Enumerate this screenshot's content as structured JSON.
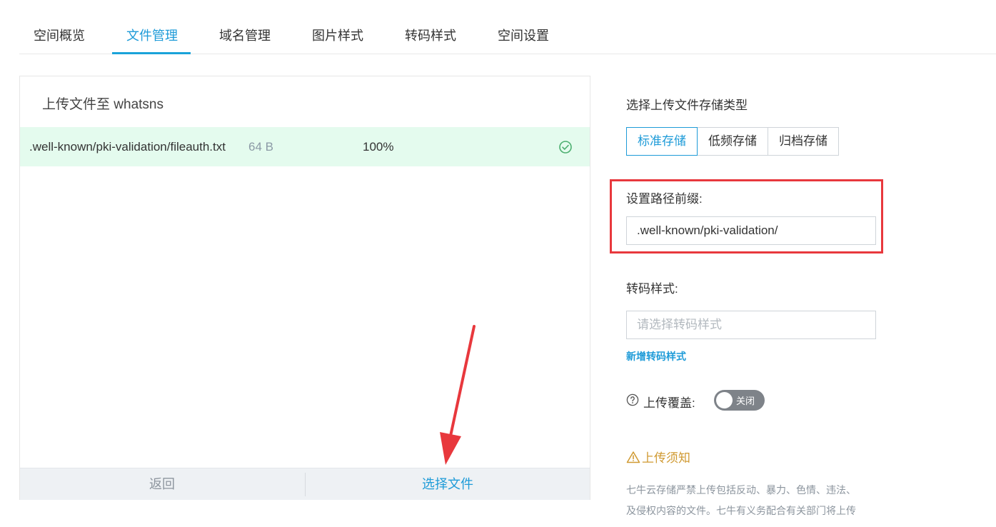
{
  "tabs": [
    {
      "label": "空间概览"
    },
    {
      "label": "文件管理"
    },
    {
      "label": "域名管理"
    },
    {
      "label": "图片样式"
    },
    {
      "label": "转码样式"
    },
    {
      "label": "空间设置"
    }
  ],
  "active_tab": "文件管理",
  "upload_panel": {
    "title": "上传文件至 whatsns",
    "files": [
      {
        "name": ".well-known/pki-validation/fileauth.txt",
        "size": "64 B",
        "progress": "100%",
        "status_icon": "check-circle-icon"
      }
    ],
    "back_label": "返回",
    "choose_label": "选择文件"
  },
  "settings": {
    "storage_type_label": "选择上传文件存储类型",
    "storage_types": [
      {
        "label": "标准存储"
      },
      {
        "label": "低频存储"
      },
      {
        "label": "归档存储"
      }
    ],
    "selected_storage": "标准存储",
    "path_prefix_label": "设置路径前缀:",
    "path_prefix_value": ".well-known/pki-validation/",
    "transcode_label": "转码样式:",
    "transcode_placeholder": "请选择转码样式",
    "add_transcode_link": "新增转码样式",
    "overwrite_label": "上传覆盖:",
    "overwrite_toggle_text": "关闭",
    "overwrite_enabled": false
  },
  "notice": {
    "title": "上传须知",
    "lines": [
      "七牛云存储严禁上传包括反动、暴力、色情、违法、",
      "及侵权内容的文件。七牛有义务配合有关部门将上传"
    ]
  },
  "colors": {
    "accent": "#1e9bd8",
    "highlight_box": "#e8383d",
    "file_row_bg": "#e4fbee",
    "success": "#4caf70",
    "warning": "#d09a32"
  }
}
